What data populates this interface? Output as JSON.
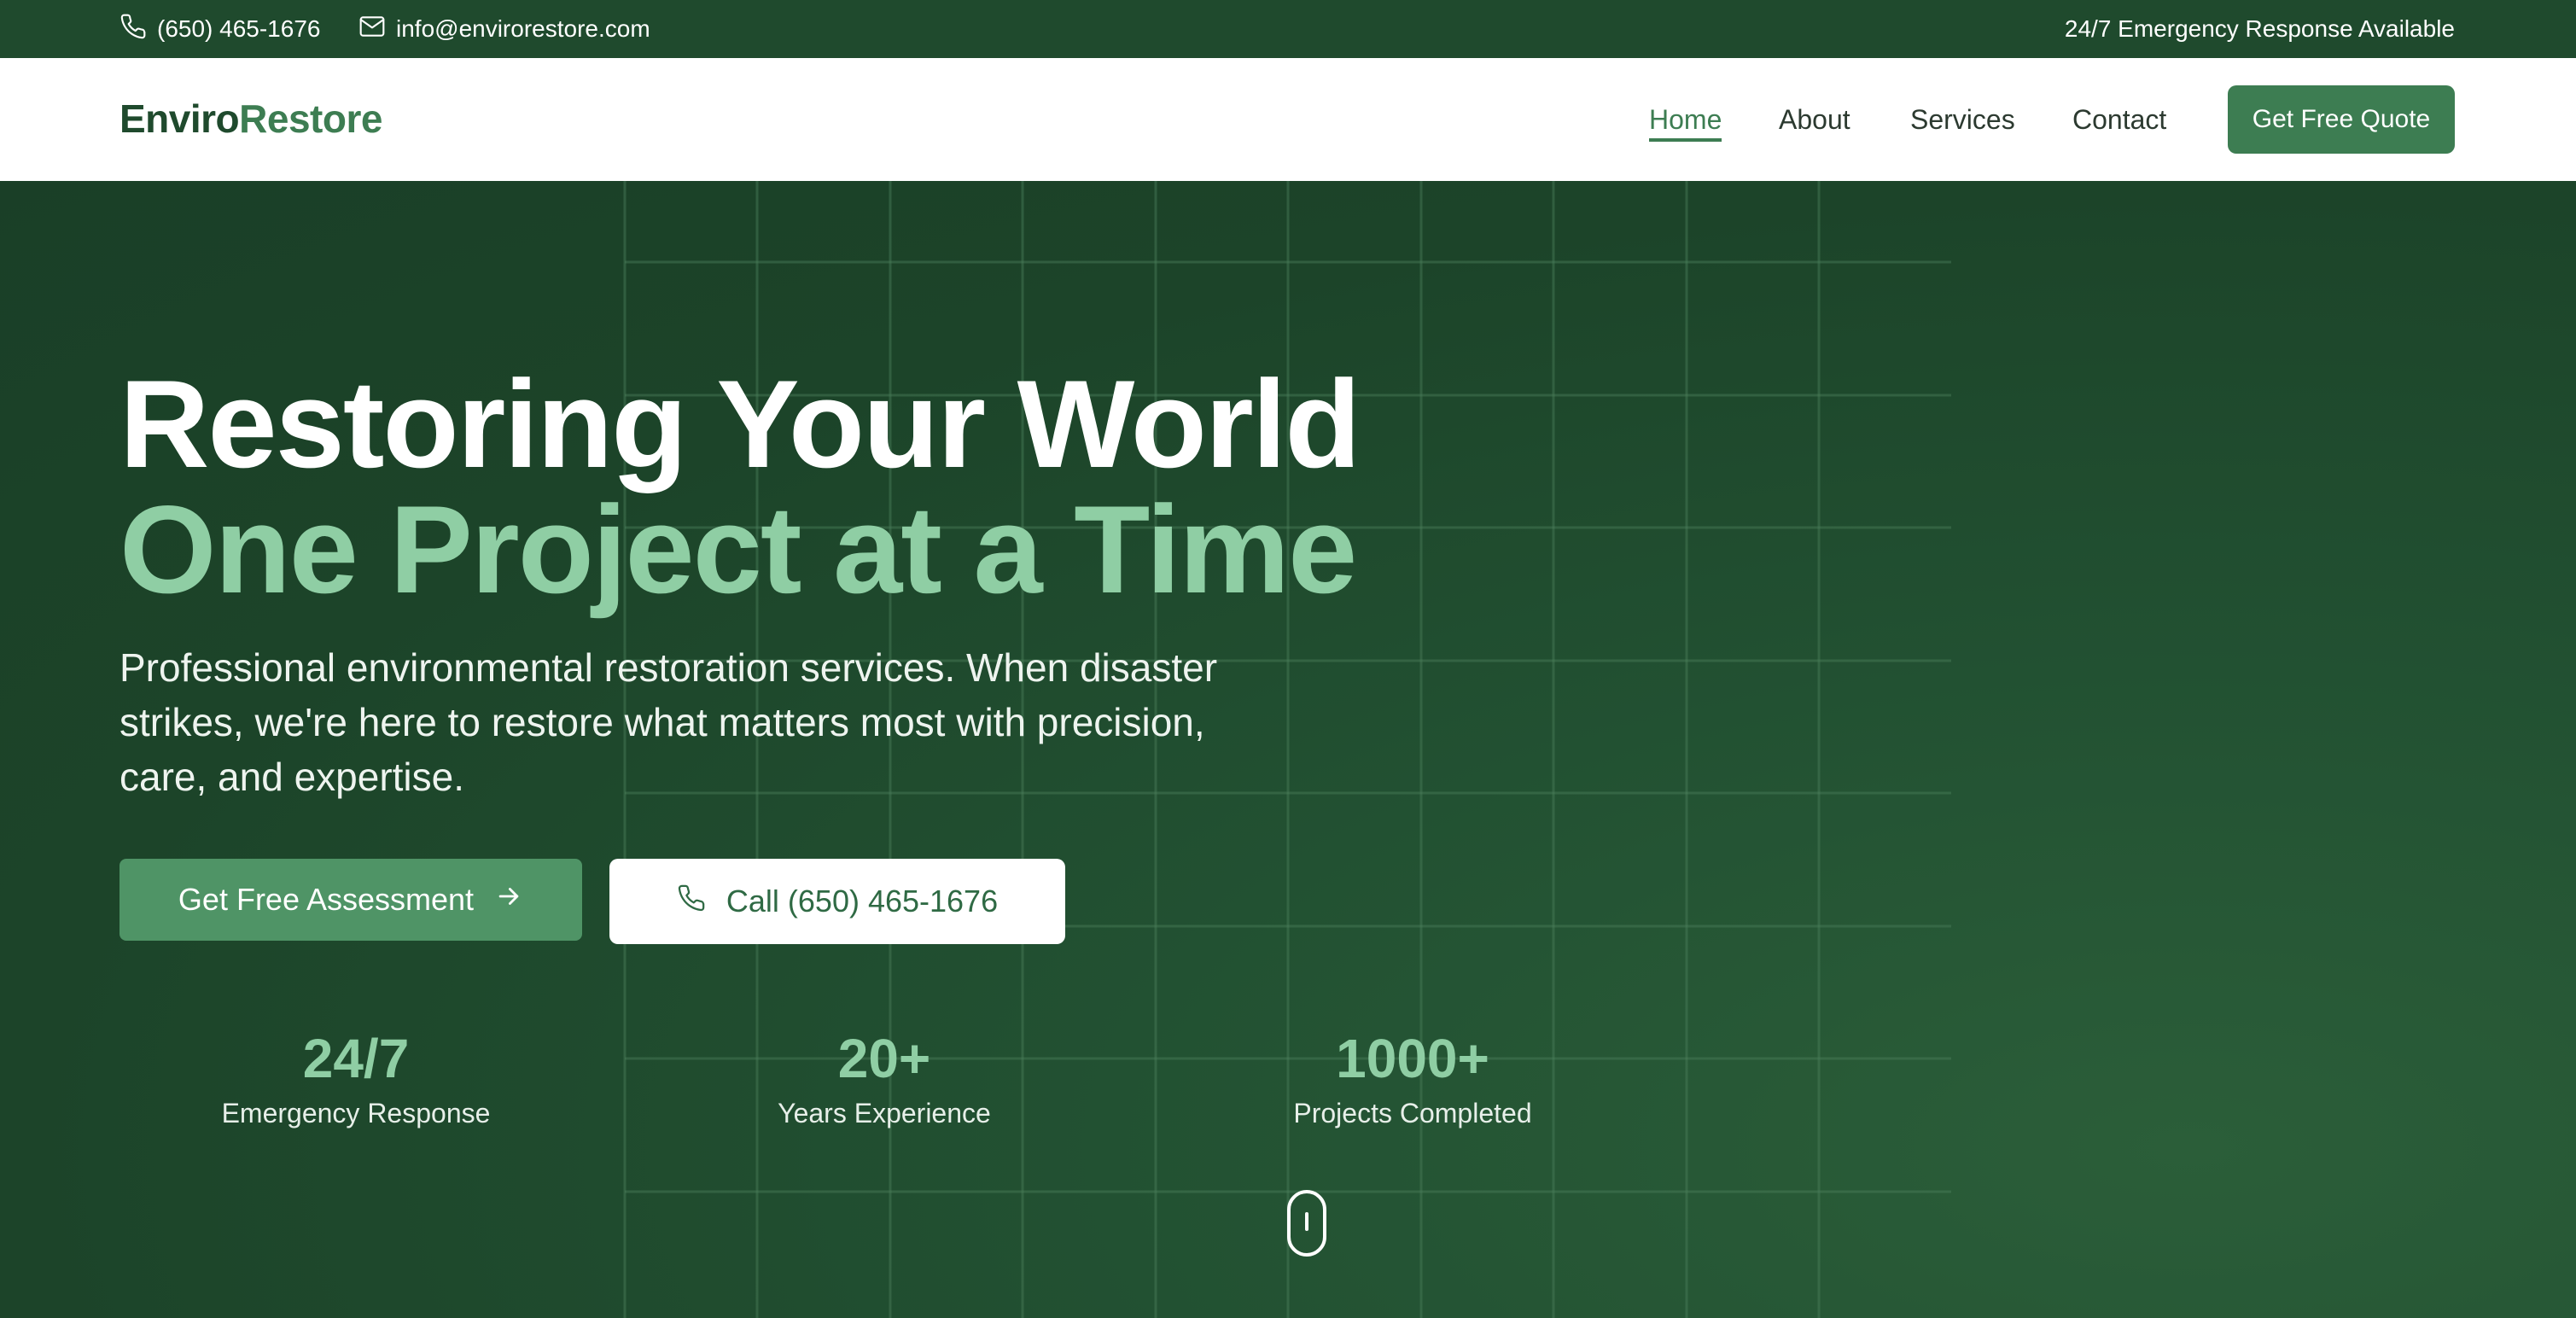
{
  "topbar": {
    "phone": "(650) 465-1676",
    "email": "info@envirorestore.com",
    "emergency": "24/7 Emergency Response Available",
    "phone_icon": "phone-icon",
    "email_icon": "mail-icon"
  },
  "navbar": {
    "logo_part1": "Enviro",
    "logo_part2": "Restore",
    "links": [
      {
        "label": "Home",
        "active": true
      },
      {
        "label": "About",
        "active": false
      },
      {
        "label": "Services",
        "active": false
      },
      {
        "label": "Contact",
        "active": false
      }
    ],
    "cta": "Get Free Quote"
  },
  "hero": {
    "title_line1": "Restoring Your World",
    "title_line2": "One Project at a Time",
    "description": "Professional environmental restoration services. When disaster strikes, we're here to restore what matters most with precision, care, and expertise.",
    "primary_button": "Get Free Assessment",
    "primary_icon": "arrow-right-icon",
    "secondary_button": "Call (650) 465-1676",
    "secondary_icon": "phone-icon",
    "stats": [
      {
        "value": "24/7",
        "label": "Emergency Response"
      },
      {
        "value": "20+",
        "label": "Years Experience"
      },
      {
        "value": "1000+",
        "label": "Projects Completed"
      }
    ],
    "scroll_icon": "mouse-scroll-icon"
  },
  "colors": {
    "brand_dark": "#1f4a2d",
    "brand": "#3d7d52",
    "accent_light": "#8fcea4",
    "button_green": "#4f9466"
  }
}
